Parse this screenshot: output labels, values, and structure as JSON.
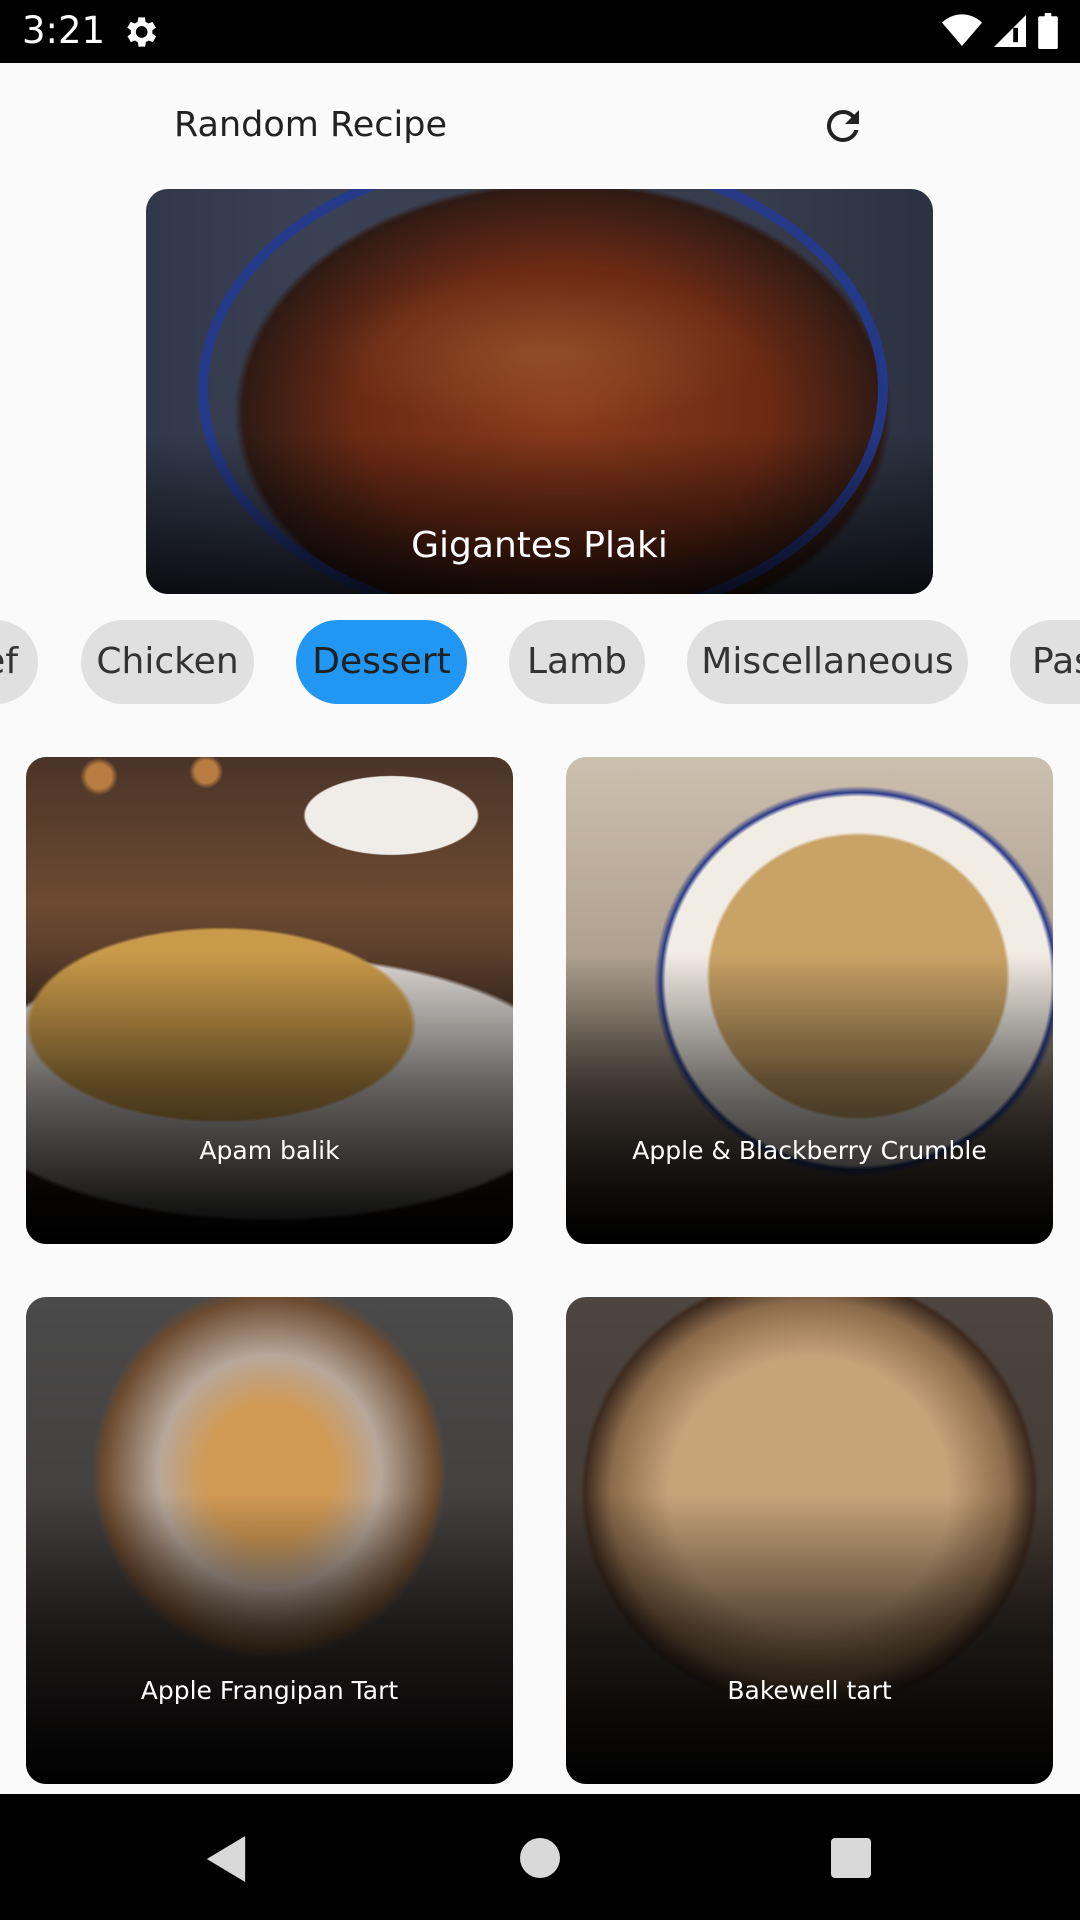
{
  "status_bar": {
    "time": "3:21",
    "icons": [
      "gear-icon",
      "wifi-icon",
      "cellular-signal-icon",
      "battery-icon"
    ]
  },
  "header": {
    "title": "Random Recipe",
    "refresh_icon": "refresh-icon"
  },
  "hero": {
    "title": "Gigantes Plaki"
  },
  "categories": {
    "items": [
      "Beef",
      "Chicken",
      "Dessert",
      "Lamb",
      "Miscellaneous",
      "Pasta"
    ],
    "selected": "Dessert"
  },
  "recipes": [
    {
      "name": "Apam balik"
    },
    {
      "name": "Apple & Blackberry Crumble"
    },
    {
      "name": "Apple Frangipan Tart"
    },
    {
      "name": "Bakewell tart"
    }
  ],
  "nav": {
    "icons": [
      "back-icon",
      "home-icon",
      "recents-icon"
    ]
  },
  "colors": {
    "accent": "#2196f3",
    "chip_bg": "#e0e0e0",
    "background": "#fafafa"
  }
}
